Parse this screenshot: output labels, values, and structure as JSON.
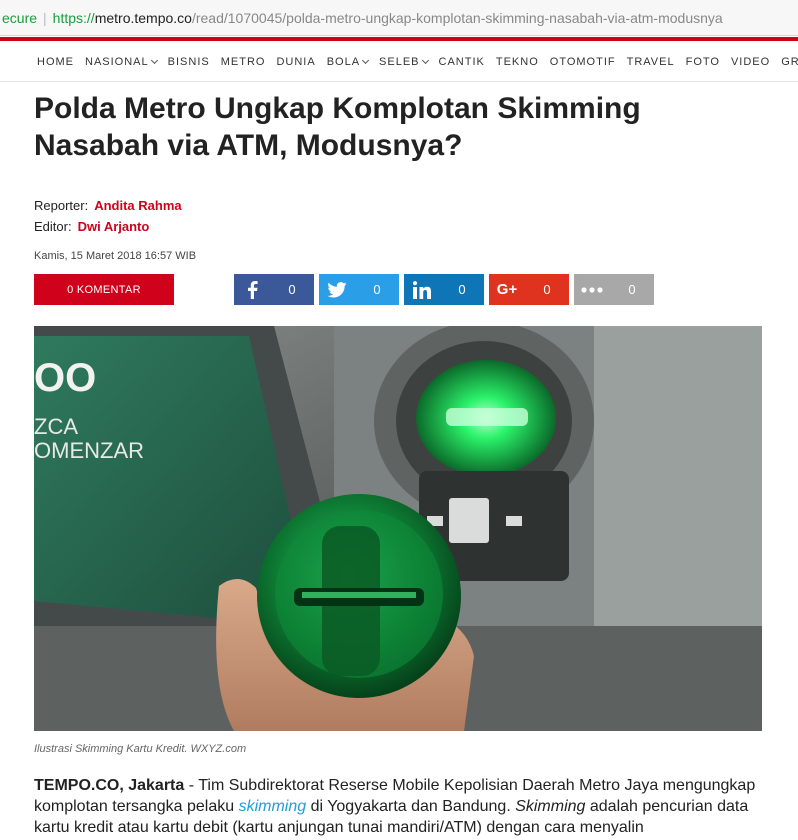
{
  "browser": {
    "secure_label": "ecure",
    "url_proto": "https://",
    "url_host": "metro.tempo.co",
    "url_path": "/read/1070045/polda-metro-ungkap-komplotan-skimming-nasabah-via-atm-modusnya"
  },
  "nav": {
    "items": [
      {
        "label": "HOME",
        "dropdown": false
      },
      {
        "label": "NASIONAL",
        "dropdown": true
      },
      {
        "label": "BISNIS",
        "dropdown": false
      },
      {
        "label": "METRO",
        "dropdown": false
      },
      {
        "label": "DUNIA",
        "dropdown": false
      },
      {
        "label": "BOLA",
        "dropdown": true
      },
      {
        "label": "SELEB",
        "dropdown": true
      },
      {
        "label": "CANTIK",
        "dropdown": false
      },
      {
        "label": "TEKNO",
        "dropdown": false
      },
      {
        "label": "OTOMOTIF",
        "dropdown": false
      },
      {
        "label": "TRAVEL",
        "dropdown": false
      },
      {
        "label": "FOTO",
        "dropdown": false
      },
      {
        "label": "VIDEO",
        "dropdown": false
      },
      {
        "label": "GRAFIS",
        "dropdown": true
      }
    ]
  },
  "article": {
    "title": "Polda Metro Ungkap Komplotan Skimming Nasabah via ATM, Modusnya?",
    "reporter_label": "Reporter:",
    "reporter_name": "Andita Rahma",
    "editor_label": "Editor:",
    "editor_name": "Dwi Arjanto",
    "date": "Kamis, 15 Maret 2018 16:57 WIB",
    "comment_button": "0 KOMENTAR",
    "caption": "Ilustrasi Skimming Kartu Kredit. WXYZ.com",
    "body": {
      "dateline": "TEMPO.CO, Jakarta",
      "part1": " - Tim Subdirektorat Reserse Mobile Kepolisian Daerah Metro Jaya mengungkap komplotan tersangka pelaku ",
      "link": "skimming",
      "part2": " di Yogyakarta dan Bandung. ",
      "italic": "Skimming",
      "part3": " adalah pencurian data kartu kredit atau kartu debit (kartu anjungan tunai mandiri/ATM) dengan cara menyalin"
    }
  },
  "share": {
    "facebook_count": "0",
    "twitter_count": "0",
    "linkedin_count": "0",
    "googleplus_count": "0",
    "more_count": "0",
    "googleplus_label": "G+"
  },
  "photo": {
    "screen_text_1": "OO",
    "screen_text_2": "ZCA",
    "screen_text_3": "OMENZAR",
    "accent": "#1fd95a"
  }
}
